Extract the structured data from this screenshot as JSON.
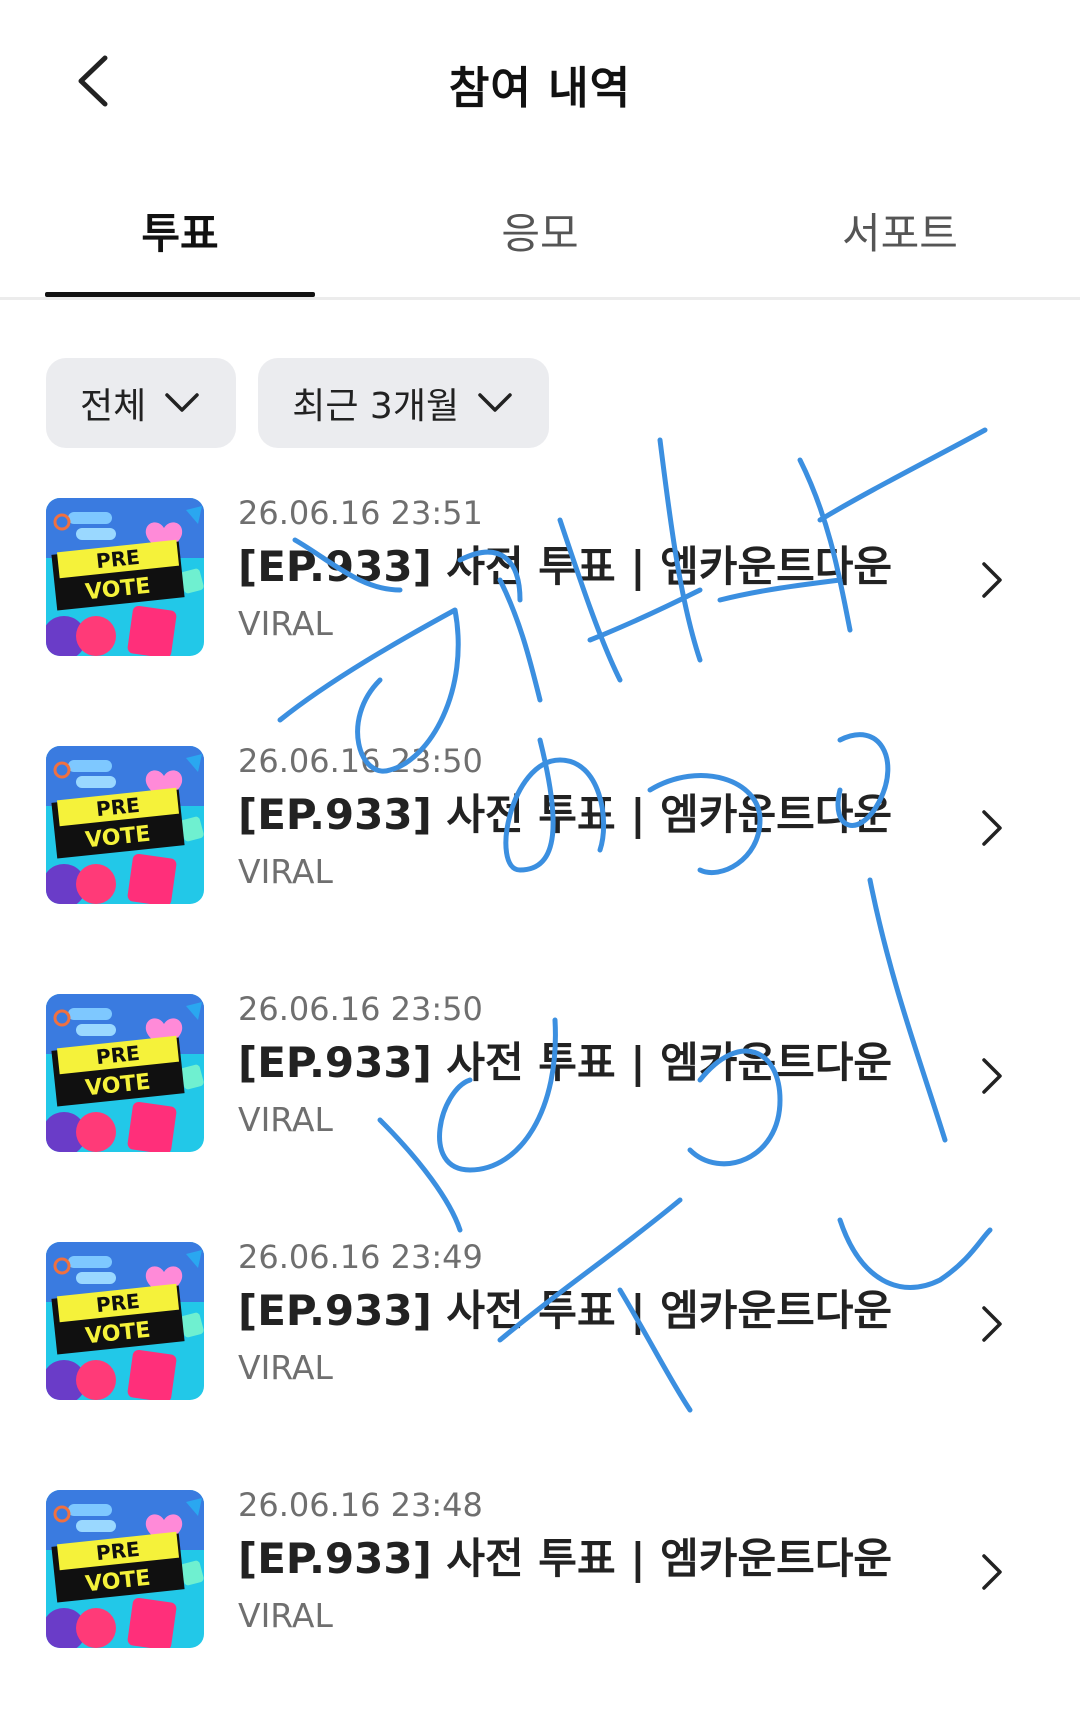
{
  "header": {
    "title": "참여 내역",
    "back_icon": "chevron-left-icon"
  },
  "tabs": [
    {
      "label": "투표",
      "active": true
    },
    {
      "label": "응모",
      "active": false
    },
    {
      "label": "서포트",
      "active": false
    }
  ],
  "filters": [
    {
      "label": "전체",
      "icon": "chevron-down-icon"
    },
    {
      "label": "최근 3개월",
      "icon": "chevron-down-icon"
    }
  ],
  "items": [
    {
      "date": "26.06.16 23:51",
      "title": "[EP.933] 사전 투표 | 엠카운트다운",
      "category": "VIRAL",
      "thumb_top": "PRE",
      "thumb_bottom": "VOTE"
    },
    {
      "date": "26.06.16 23:50",
      "title": "[EP.933] 사전 투표 | 엠카운트다운",
      "category": "VIRAL",
      "thumb_top": "PRE",
      "thumb_bottom": "VOTE"
    },
    {
      "date": "26.06.16 23:50",
      "title": "[EP.933] 사전 투표 | 엠카운트다운",
      "category": "VIRAL",
      "thumb_top": "PRE",
      "thumb_bottom": "VOTE"
    },
    {
      "date": "26.06.16 23:49",
      "title": "[EP.933] 사전 투표 | 엠카운트다운",
      "category": "VIRAL",
      "thumb_top": "PRE",
      "thumb_bottom": "VOTE"
    },
    {
      "date": "26.06.16 23:48",
      "title": "[EP.933] 사전 투표 | 엠카운트다운",
      "category": "VIRAL",
      "thumb_top": "PRE",
      "thumb_bottom": "VOTE"
    }
  ],
  "colors": {
    "scribble": "#3b8fe0",
    "tab_active": "#111111",
    "chip_bg": "#ebecef",
    "thumb_bg": "#22c8e8",
    "thumb_band": "#f5f23a"
  }
}
